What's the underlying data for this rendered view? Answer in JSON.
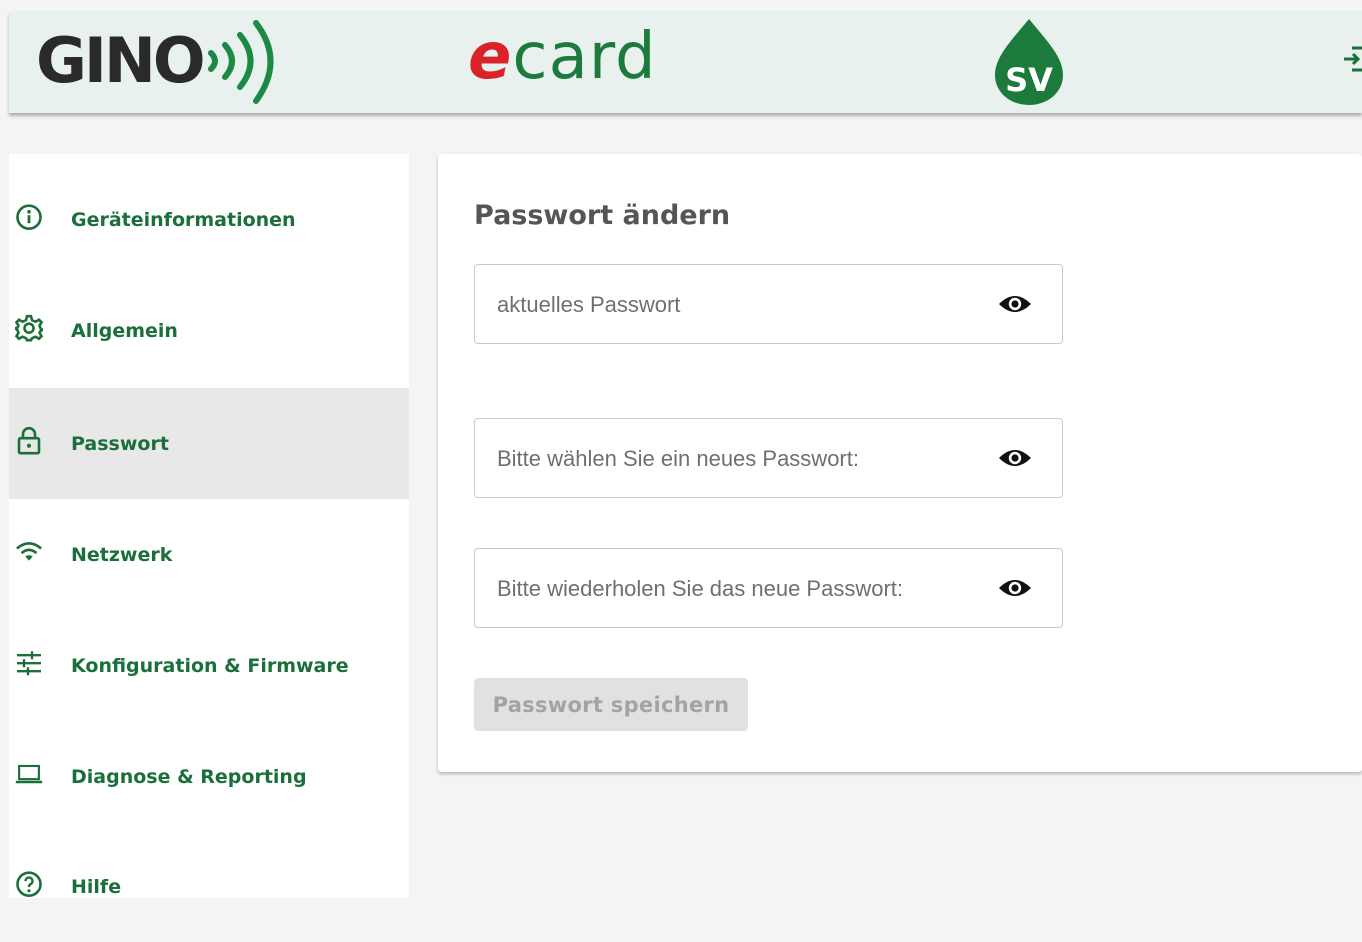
{
  "header": {
    "logo_gino": "GINO",
    "logo_ecard_e": "e",
    "logo_ecard_rest": "card",
    "logo_sv": "SV",
    "logout_icon": "logout-icon"
  },
  "sidebar": {
    "items": [
      {
        "label": "Geräteinformationen",
        "icon": "info-icon",
        "active": false
      },
      {
        "label": "Allgemein",
        "icon": "gear-icon",
        "active": false
      },
      {
        "label": "Passwort",
        "icon": "lock-icon",
        "active": true
      },
      {
        "label": "Netzwerk",
        "icon": "wifi-icon",
        "active": false
      },
      {
        "label": "Konfiguration & Firmware",
        "icon": "tune-icon",
        "active": false
      },
      {
        "label": "Diagnose & Reporting",
        "icon": "laptop-icon",
        "active": false
      },
      {
        "label": "Hilfe",
        "icon": "help-icon",
        "active": false
      }
    ]
  },
  "main": {
    "title": "Passwort ändern",
    "current_password": {
      "placeholder": "aktuelles Passwort",
      "value": ""
    },
    "new_password": {
      "placeholder": "Bitte wählen Sie ein neues Passwort:",
      "value": ""
    },
    "repeat_password": {
      "placeholder": "Bitte wiederholen Sie das neue Passwort:",
      "value": ""
    },
    "save_label": "Passwort speichern"
  },
  "colors": {
    "brand_green": "#1b6f3a",
    "header_bg": "#e9f1ee",
    "ecard_red": "#d9222a",
    "active_item_bg": "#e8e8e8",
    "disabled_button_bg": "#e1e1e1"
  }
}
